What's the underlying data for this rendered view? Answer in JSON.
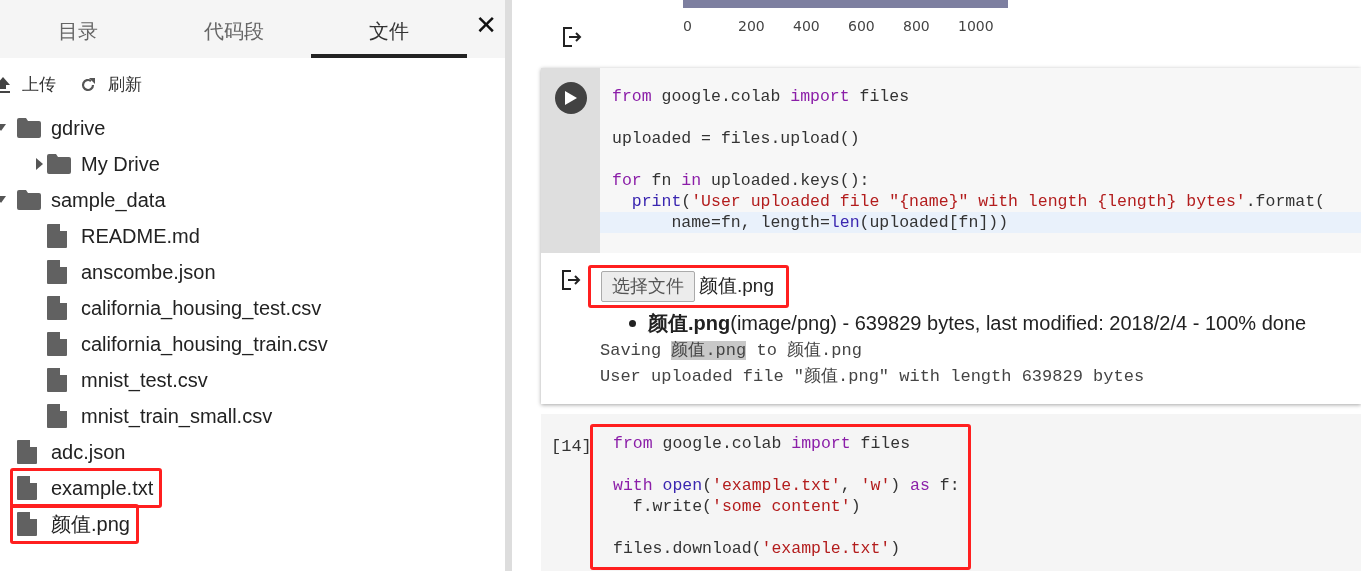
{
  "panel": {
    "tabs": [
      {
        "label": "目录",
        "selected": false
      },
      {
        "label": "代码段",
        "selected": false
      },
      {
        "label": "文件",
        "selected": true
      }
    ],
    "close": "✕",
    "actions": [
      {
        "label": "上传",
        "kind": "upload"
      },
      {
        "label": "刷新",
        "kind": "refresh"
      }
    ],
    "tree": [
      {
        "name": "gdrive",
        "kind": "folder",
        "expanded": true,
        "children": [
          {
            "name": "My Drive",
            "kind": "folder",
            "expanded": false
          }
        ]
      },
      {
        "name": "sample_data",
        "kind": "folder",
        "expanded": true,
        "children": [
          {
            "name": "README.md",
            "kind": "file"
          },
          {
            "name": "anscombe.json",
            "kind": "file"
          },
          {
            "name": "california_housing_test.csv",
            "kind": "file"
          },
          {
            "name": "california_housing_train.csv",
            "kind": "file"
          },
          {
            "name": "mnist_test.csv",
            "kind": "file"
          },
          {
            "name": "mnist_train_small.csv",
            "kind": "file"
          }
        ]
      },
      {
        "name": "adc.json",
        "kind": "file"
      },
      {
        "name": "example.txt",
        "kind": "file",
        "highlighted": true
      },
      {
        "name": "颜值.png",
        "kind": "file",
        "highlighted": true
      }
    ]
  },
  "plot_output": {
    "axis_labels": [
      "0",
      "200",
      "400",
      "600",
      "800",
      "1000"
    ]
  },
  "cells": [
    {
      "kind": "focused",
      "lines": [
        {
          "current": false,
          "tokens": [
            {
              "kind": "kw",
              "text": "from"
            },
            {
              "kind": "plain",
              "text": " google.colab "
            },
            {
              "kind": "kw",
              "text": "import"
            },
            {
              "kind": "plain",
              "text": " files"
            }
          ]
        },
        {
          "current": false,
          "blank_before": true,
          "tokens": [
            {
              "kind": "plain",
              "text": "uploaded = files.upload()"
            }
          ]
        },
        {
          "current": false,
          "blank_before": true,
          "tokens": [
            {
              "kind": "kw",
              "text": "for"
            },
            {
              "kind": "plain",
              "text": " fn "
            },
            {
              "kind": "kw",
              "text": "in"
            },
            {
              "kind": "plain",
              "text": " uploaded.keys():"
            }
          ]
        },
        {
          "current": false,
          "tokens": [
            {
              "kind": "builtin",
              "text": "  print"
            },
            {
              "kind": "plain",
              "text": "("
            },
            {
              "kind": "str",
              "text": "'User uploaded file \"{name}\" with length {length} bytes'"
            },
            {
              "kind": "plain",
              "text": ".format("
            }
          ]
        },
        {
          "current": true,
          "tokens": [
            {
              "kind": "plain",
              "text": "      name=fn, length="
            },
            {
              "kind": "builtin",
              "text": "len"
            },
            {
              "kind": "plain",
              "text": "(uploaded[fn]))"
            }
          ]
        }
      ],
      "output": {
        "upload": {
          "button": "选择文件",
          "file": "颜值.png",
          "highlighted": true
        },
        "bullet": "**颜值.png**(image/png) - 639829 bytes, last modified: 2018/2/4 - 100% done",
        "stdout": [
          [
            {
              "text": "Saving ",
              "selected": false
            },
            {
              "text": "颜值.png",
              "selected": true
            },
            {
              "text": " to 颜值.png",
              "selected": false
            }
          ],
          [
            {
              "text": "User uploaded file \"颜值.png\" with length 639829 bytes",
              "selected": false
            }
          ]
        ]
      }
    },
    {
      "kind": "executed",
      "execution_count": "[14]",
      "highlighted": true,
      "lines": [
        {
          "current": false,
          "tokens": [
            {
              "kind": "kw",
              "text": "from"
            },
            {
              "kind": "plain",
              "text": " google.colab "
            },
            {
              "kind": "kw",
              "text": "import"
            },
            {
              "kind": "plain",
              "text": " files"
            }
          ]
        },
        {
          "current": false,
          "blank_before": true,
          "tokens": [
            {
              "kind": "kw",
              "text": "with "
            },
            {
              "kind": "builtin",
              "text": "open"
            },
            {
              "kind": "plain",
              "text": "("
            },
            {
              "kind": "str",
              "text": "'example.txt'"
            },
            {
              "kind": "plain",
              "text": ", "
            },
            {
              "kind": "str",
              "text": "'w'"
            },
            {
              "kind": "plain",
              "text": ") "
            },
            {
              "kind": "kw",
              "text": "as"
            },
            {
              "kind": "plain",
              "text": " f:"
            }
          ]
        },
        {
          "current": false,
          "tokens": [
            {
              "kind": "plain",
              "text": "  f.write("
            },
            {
              "kind": "str",
              "text": "'some content'"
            },
            {
              "kind": "plain",
              "text": ")"
            }
          ]
        },
        {
          "current": false,
          "blank_before": true,
          "tokens": [
            {
              "kind": "plain",
              "text": "files.download("
            },
            {
              "kind": "str",
              "text": "'example.txt'"
            },
            {
              "kind": "plain",
              "text": ")"
            }
          ]
        }
      ]
    }
  ]
}
